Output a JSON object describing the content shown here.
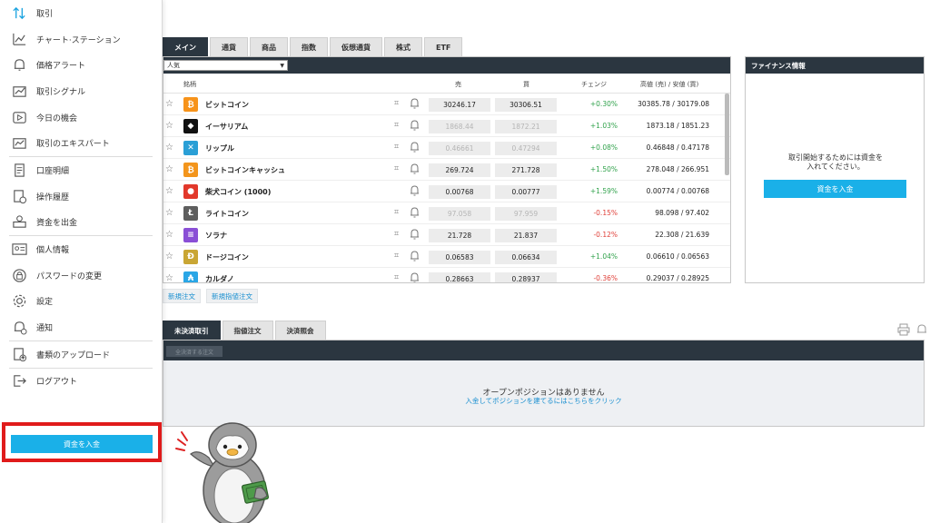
{
  "sidebar": {
    "items": [
      {
        "label": "取引",
        "icon": "updown-arrows-icon"
      },
      {
        "label": "チャート·ステーション",
        "icon": "line-chart-icon"
      },
      {
        "label": "価格アラート",
        "icon": "bell-icon"
      },
      {
        "label": "取引シグナル",
        "icon": "signal-chart-icon"
      },
      {
        "label": "今日の機会",
        "icon": "play-icon"
      },
      {
        "label": "取引のエキスパート",
        "icon": "expert-icon"
      },
      {
        "label": "口座明細",
        "icon": "statement-icon"
      },
      {
        "label": "操作履歴",
        "icon": "history-icon"
      },
      {
        "label": "資金を出金",
        "icon": "withdraw-icon"
      },
      {
        "label": "個人情報",
        "icon": "id-card-icon"
      },
      {
        "label": "パスワードの変更",
        "icon": "password-icon"
      },
      {
        "label": "設定",
        "icon": "gear-icon"
      },
      {
        "label": "通知",
        "icon": "notification-icon"
      },
      {
        "label": "書類のアップロード",
        "icon": "upload-doc-icon"
      },
      {
        "label": "ログアウト",
        "icon": "logout-icon"
      }
    ],
    "deposit_label": "資金を入金"
  },
  "market": {
    "tabs": [
      "メイン",
      "通貨",
      "商品",
      "指数",
      "仮想通貨",
      "株式",
      "ETF"
    ],
    "category": "人気",
    "columns": {
      "instrument": "銘柄",
      "sell": "売",
      "buy": "買",
      "change": "チェンジ",
      "highlow": "高値 (売) / 安値 (買)"
    },
    "rows": [
      {
        "name": "ビットコイン",
        "logo_color": "#f7931a",
        "logo": "₿",
        "sell": "30246.17",
        "buy": "30306.51",
        "sell_dim": false,
        "change": "+0.30%",
        "dir": "up",
        "highlow": "30385.78 / 30179.08",
        "chart": true
      },
      {
        "name": "イーサリアム",
        "logo_color": "#111111",
        "logo": "◆",
        "sell": "1868.44",
        "buy": "1872.21",
        "sell_dim": true,
        "change": "+1.03%",
        "dir": "up",
        "highlow": "1873.18 / 1851.23",
        "chart": true
      },
      {
        "name": "リップル",
        "logo_color": "#2a9fd6",
        "logo": "✕",
        "sell": "0.46661",
        "buy": "0.47294",
        "sell_dim": true,
        "change": "+0.08%",
        "dir": "up",
        "highlow": "0.46848 / 0.47178",
        "chart": true
      },
      {
        "name": "ビットコインキャッシュ",
        "logo_color": "#f3951c",
        "logo": "₿",
        "sell": "269.724",
        "buy": "271.728",
        "sell_dim": false,
        "change": "+1.50%",
        "dir": "up",
        "highlow": "278.048 / 266.951",
        "chart": true
      },
      {
        "name": "柴犬コイン (1000)",
        "logo_color": "#e2382b",
        "logo": "●",
        "sell": "0.00768",
        "buy": "0.00777",
        "sell_dim": false,
        "change": "+1.59%",
        "dir": "up",
        "highlow": "0.00774 / 0.00768",
        "chart": false
      },
      {
        "name": "ライトコイン",
        "logo_color": "#5e5e5e",
        "logo": "Ł",
        "sell": "97.058",
        "buy": "97.959",
        "sell_dim": true,
        "change": "-0.15%",
        "dir": "down",
        "highlow": "98.098 / 97.402",
        "chart": true
      },
      {
        "name": "ソラナ",
        "logo_color": "#8a4fd6",
        "logo": "≡",
        "sell": "21.728",
        "buy": "21.837",
        "sell_dim": false,
        "change": "-0.12%",
        "dir": "down",
        "highlow": "22.308 / 21.639",
        "chart": true
      },
      {
        "name": "ドージコイン",
        "logo_color": "#c9a634",
        "logo": "Ð",
        "sell": "0.06583",
        "buy": "0.06634",
        "sell_dim": false,
        "change": "+1.04%",
        "dir": "up",
        "highlow": "0.06610 / 0.06563",
        "chart": true
      },
      {
        "name": "カルダノ",
        "logo_color": "#2aa6e6",
        "logo": "₳",
        "sell": "0.28663",
        "buy": "0.28937",
        "sell_dim": false,
        "change": "-0.36%",
        "dir": "down",
        "highlow": "0.29037 / 0.28925",
        "chart": true
      }
    ],
    "order_buttons": [
      "新規注文",
      "新規指値注文"
    ]
  },
  "finance": {
    "title": "ファイナンス情報",
    "message_line1": "取引開始するためには資金を",
    "message_line2": "入れてください。",
    "deposit_label": "資金を入金"
  },
  "positions": {
    "tabs": [
      "未決済取引",
      "指値注文",
      "決済照会"
    ],
    "close_all": "全決済する注文",
    "empty_title": "オープンポジションはありません",
    "empty_link": "入金してポジションを建てるにはこちらをクリック"
  },
  "colors": {
    "accent": "#1ab0e8",
    "header": "#2b3640",
    "highlight_box": "#e01b1b",
    "up": "#31a24c",
    "down": "#e0413a"
  }
}
